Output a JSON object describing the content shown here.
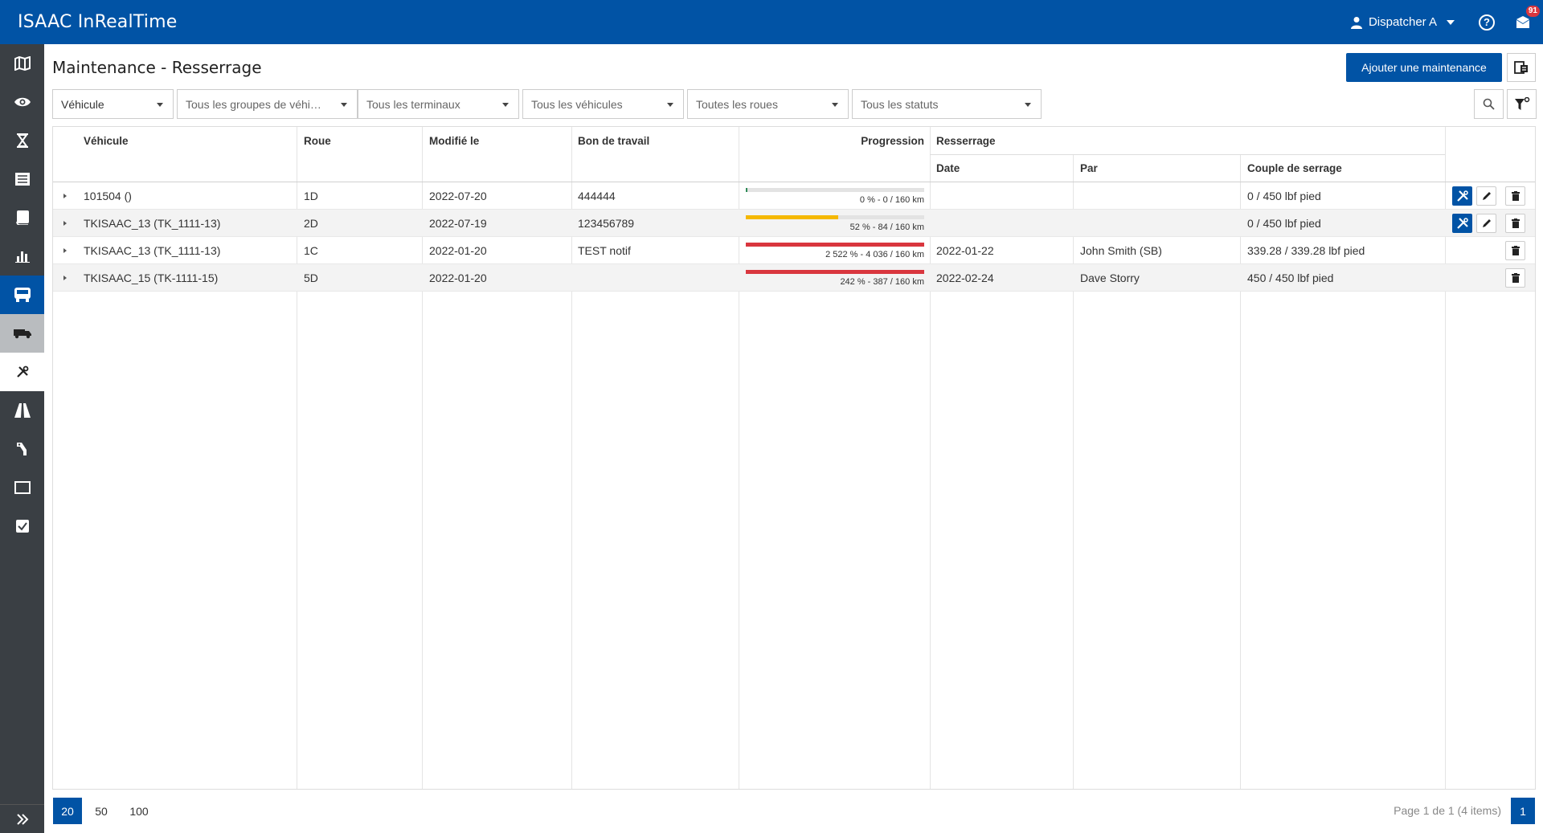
{
  "app": {
    "title": "ISAAC InRealTime"
  },
  "header": {
    "user": "Dispatcher A",
    "help_icon": "question-circle-icon",
    "notifications_count": "91"
  },
  "page": {
    "title": "Maintenance - Resserrage",
    "add_button": "Ajouter une maintenance"
  },
  "filters": [
    {
      "label": "Véhicule",
      "is_value": true
    },
    {
      "label": "Tous les groupes de véhic…"
    },
    {
      "label": "Tous les terminaux"
    },
    {
      "label": "Tous les véhicules"
    },
    {
      "label": "Toutes les roues"
    },
    {
      "label": "Tous les statuts"
    }
  ],
  "grid": {
    "headers": {
      "vehicle": "Véhicule",
      "wheel": "Roue",
      "modified": "Modifié le",
      "work_order": "Bon de travail",
      "progress": "Progression",
      "tightening": "Resserrage",
      "date": "Date",
      "by": "Par",
      "torque": "Couple de serrage"
    },
    "rows": [
      {
        "vehicle": "101504 ()",
        "wheel": "1D",
        "modified": "2022-07-20",
        "work_order": "444444",
        "progress_pct": 0,
        "progress_text": "0 % - 0 / 160 km",
        "progress_color": "#2e8b57",
        "date": "",
        "by": "",
        "torque": "0 / 450 lbf pied",
        "actions": [
          "wrench",
          "edit",
          "delete"
        ]
      },
      {
        "vehicle": "TKISAAC_13 (TK_1111-13)",
        "wheel": "2D",
        "modified": "2022-07-19",
        "work_order": "123456789",
        "progress_pct": 52,
        "progress_text": "52 % - 84 / 160 km",
        "progress_color": "#f5b800",
        "date": "",
        "by": "",
        "torque": "0 / 450 lbf pied",
        "actions": [
          "wrench",
          "edit",
          "delete"
        ]
      },
      {
        "vehicle": "TKISAAC_13 (TK_1111-13)",
        "wheel": "1C",
        "modified": "2022-01-20",
        "work_order": "TEST notif",
        "progress_pct": 100,
        "progress_text": "2 522 % - 4 036 / 160 km",
        "progress_color": "#d9363e",
        "date": "2022-01-22",
        "by": "John Smith (SB)",
        "torque": "339.28 / 339.28 lbf pied",
        "actions": [
          "delete"
        ]
      },
      {
        "vehicle": "TKISAAC_15 (TK-1111-15)",
        "wheel": "5D",
        "modified": "2022-01-20",
        "work_order": "",
        "progress_pct": 100,
        "progress_text": "242 % - 387 / 160 km",
        "progress_color": "#d9363e",
        "date": "2022-02-24",
        "by": "Dave Storry",
        "torque": "450 / 450 lbf pied",
        "actions": [
          "delete"
        ]
      }
    ]
  },
  "pager": {
    "sizes": [
      "20",
      "50",
      "100"
    ],
    "selected": "20",
    "info": "Page 1 de 1 (4 items)",
    "current_page": "1"
  },
  "sidebar": [
    {
      "icon": "map-icon"
    },
    {
      "icon": "eye-icon"
    },
    {
      "icon": "hourglass-icon"
    },
    {
      "icon": "list-icon"
    },
    {
      "icon": "book-icon"
    },
    {
      "icon": "bar-chart-icon"
    },
    {
      "icon": "bus-icon",
      "active": true
    },
    {
      "icon": "truck-icon",
      "sub": true
    },
    {
      "icon": "tools-icon",
      "sub": true,
      "selected": true
    },
    {
      "icon": "road-icon"
    },
    {
      "icon": "pump-icon"
    },
    {
      "icon": "screen-icon"
    },
    {
      "icon": "checklist-icon"
    }
  ]
}
